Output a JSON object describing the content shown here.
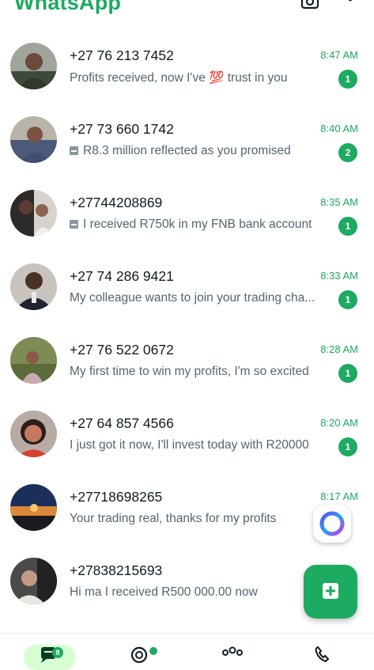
{
  "header": {
    "title": "WhatsApp",
    "icons": [
      "camera-icon",
      "more-options-icon"
    ]
  },
  "chats": [
    {
      "name": "+27 76 213 7452",
      "time": "8:47 AM",
      "preview": "Profits received, now I've 💯 trust in you",
      "unread": "1",
      "has_image_icon": false
    },
    {
      "name": "+27 73 660 1742",
      "time": "8:40 AM",
      "preview": "R8.3 million reflected as you promised",
      "unread": "2",
      "has_image_icon": true
    },
    {
      "name": "+27744208869",
      "time": "8:35 AM",
      "preview": "I received R750k in my FNB bank account",
      "unread": "1",
      "has_image_icon": true
    },
    {
      "name": "+27 74 286 9421",
      "time": "8:33 AM",
      "preview": "My colleague wants to join your trading cha...",
      "unread": "1",
      "has_image_icon": false
    },
    {
      "name": "+27 76 522 0672",
      "time": "8:28 AM",
      "preview": "My first time to win my profits, I'm so excited",
      "unread": "1",
      "has_image_icon": false
    },
    {
      "name": "+27 64 857 4566",
      "time": "8:20 AM",
      "preview": "I just got it now, I'll invest today with R20000",
      "unread": "1",
      "has_image_icon": false
    },
    {
      "name": "+27718698265",
      "time": "8:17 AM",
      "preview": "Your trading real, thanks for my profits",
      "unread": "",
      "has_image_icon": false
    },
    {
      "name": "+27838215693",
      "time": "",
      "preview": "Hi ma I received R500 000.00 now",
      "unread": "",
      "has_image_icon": false
    }
  ],
  "fab": {
    "meta_ai_icon": "meta-ai-icon",
    "new_chat_icon": "new-chat-icon"
  },
  "bottom_nav": {
    "chats_badge": "8",
    "icons": [
      "chats-icon",
      "updates-icon",
      "communities-icon",
      "calls-icon"
    ]
  },
  "colors": {
    "accent": "#1daa61",
    "active_pill": "#d8fdd2",
    "text_primary": "#111b21",
    "text_secondary": "#54656f"
  }
}
